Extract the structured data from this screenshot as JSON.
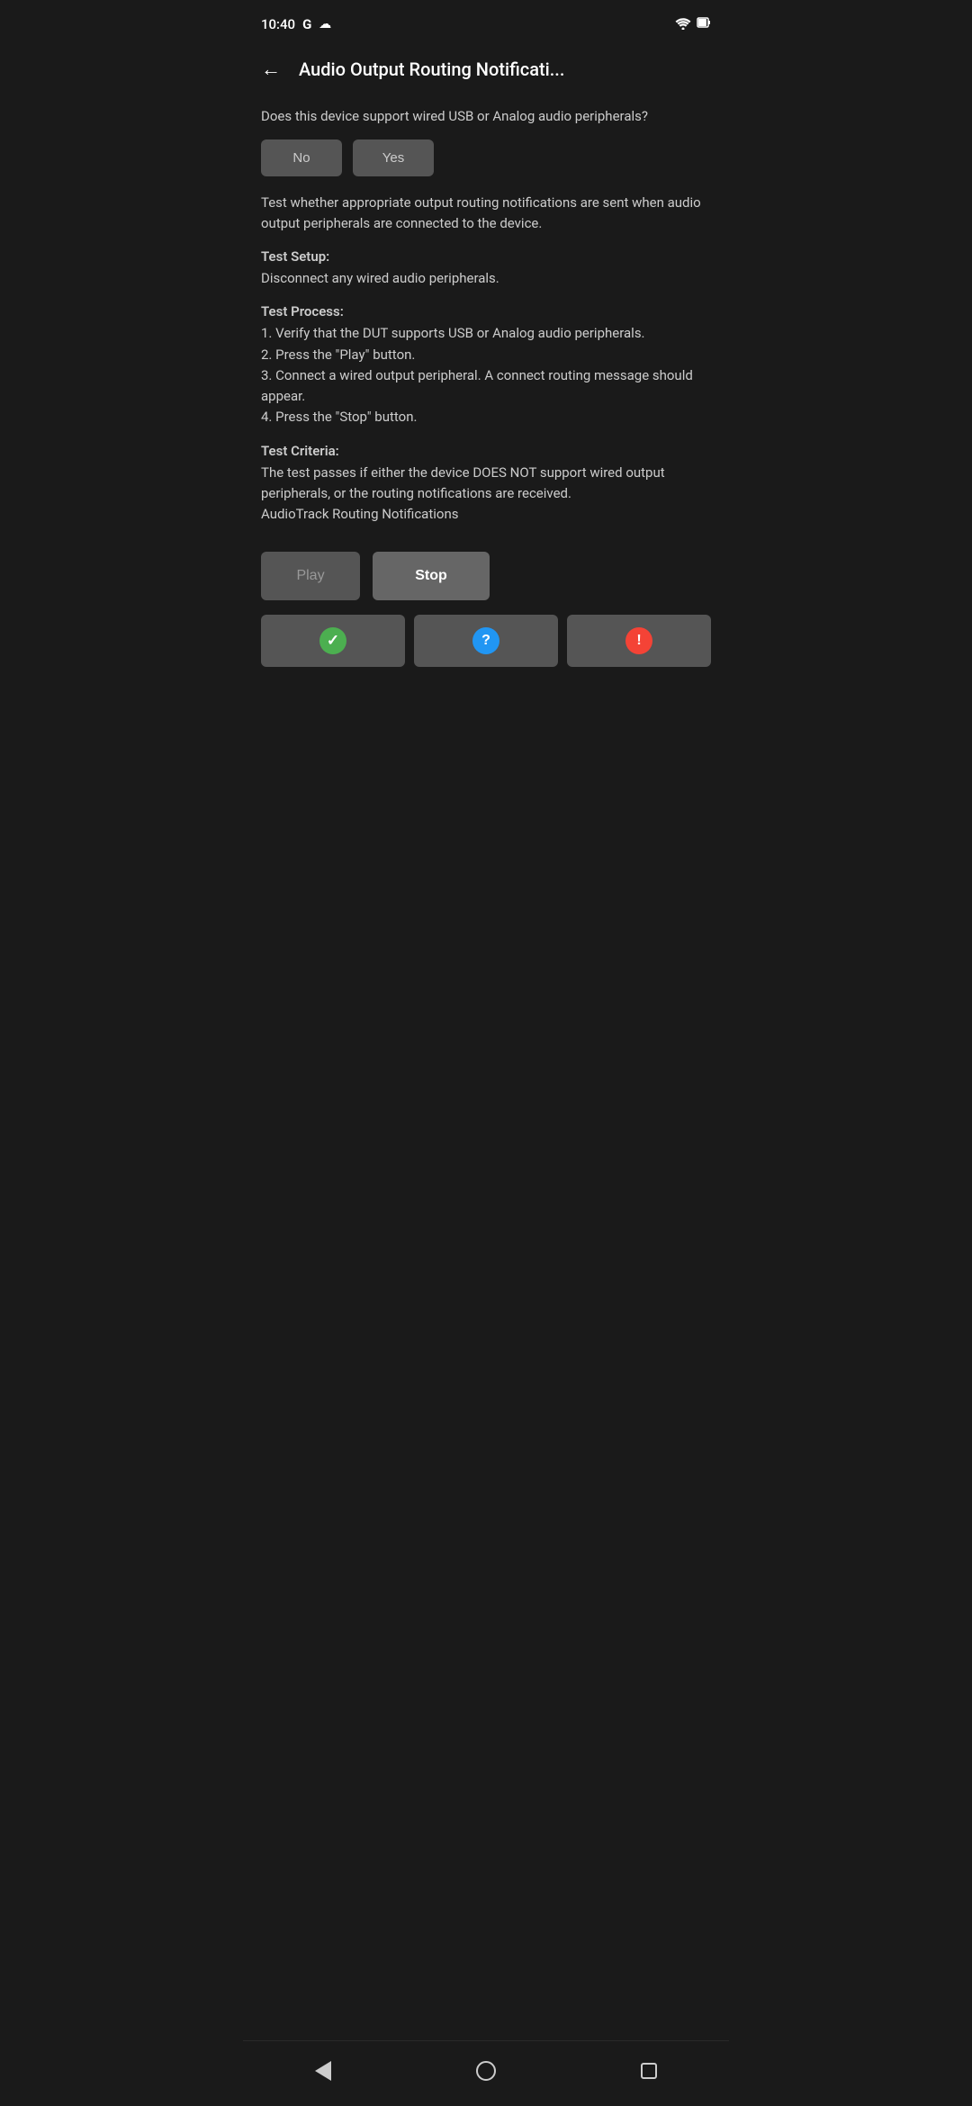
{
  "statusBar": {
    "time": "10:40",
    "googleLabel": "G",
    "cloudLabel": "☁",
    "wifiLabel": "WiFi",
    "batteryLabel": "Battery"
  },
  "header": {
    "backLabel": "←",
    "title": "Audio Output Routing Notificati..."
  },
  "content": {
    "questionText": "Does this device support wired USB or Analog audio peripherals?",
    "noLabel": "No",
    "yesLabel": "Yes",
    "descriptionText": "Test whether appropriate output routing notifications are sent when audio output peripherals are connected to the device.",
    "testSetupHeader": "Test Setup:",
    "testSetupBody": "Disconnect any wired audio peripherals.",
    "testProcessHeader": "Test Process:",
    "testProcessBody": "1. Verify that the DUT supports USB or Analog audio peripherals.\n2. Press the \"Play\" button.\n3. Connect a wired output peripheral. A connect routing message should appear.\n4. Press the \"Stop\" button.",
    "testCriteriaHeader": "Test Criteria:",
    "testCriteriaBody": "The test passes if either the device DOES NOT support wired output peripherals, or the routing notifications are received.\nAudioTrack Routing Notifications"
  },
  "controls": {
    "playLabel": "Play",
    "stopLabel": "Stop",
    "passTitle": "Pass",
    "infoTitle": "Info",
    "failTitle": "Fail"
  },
  "bottomNav": {
    "backLabel": "Back",
    "homeLabel": "Home",
    "recentLabel": "Recent"
  }
}
